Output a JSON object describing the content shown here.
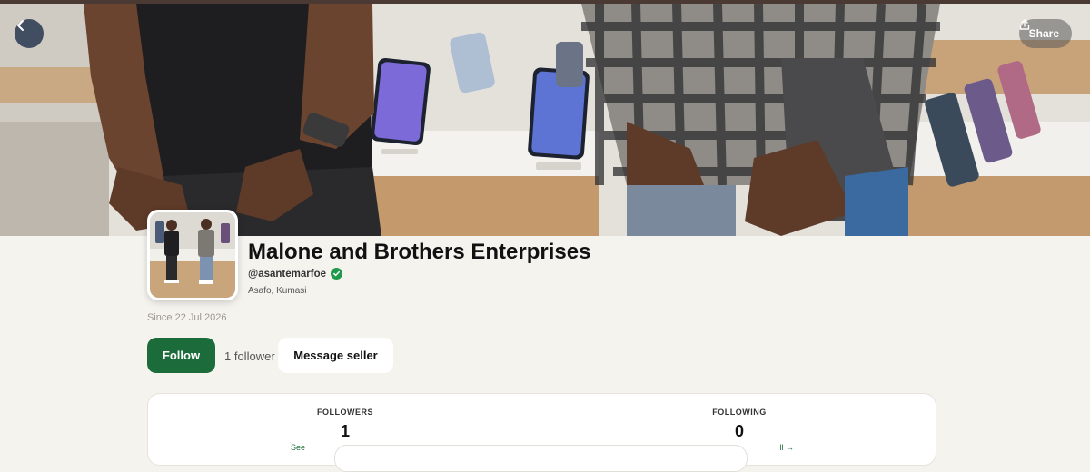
{
  "header": {
    "back_icon": "chevron-left-icon",
    "share_label": "Share",
    "share_icon": "share-icon"
  },
  "profile": {
    "name": "Malone and Brothers Enterprises",
    "handle": "@asantemarfoe",
    "verified_icon": "verified-check-icon",
    "location": "Asafo, Kumasi",
    "since": "Since 22 Jul 2026"
  },
  "actions": {
    "follow_label": "Follow",
    "follower_count_text": "1 follower",
    "message_label": "Message seller"
  },
  "stats": {
    "followers_label": "FOLLOWERS",
    "followers_value": "1",
    "followers_link": "See",
    "following_label": "FOLLOWING",
    "following_value": "0",
    "following_link": "ll →"
  },
  "colors": {
    "brand_green": "#1c6b3a",
    "verified_green": "#1e9a4a",
    "page_bg": "#f5f3ee"
  }
}
